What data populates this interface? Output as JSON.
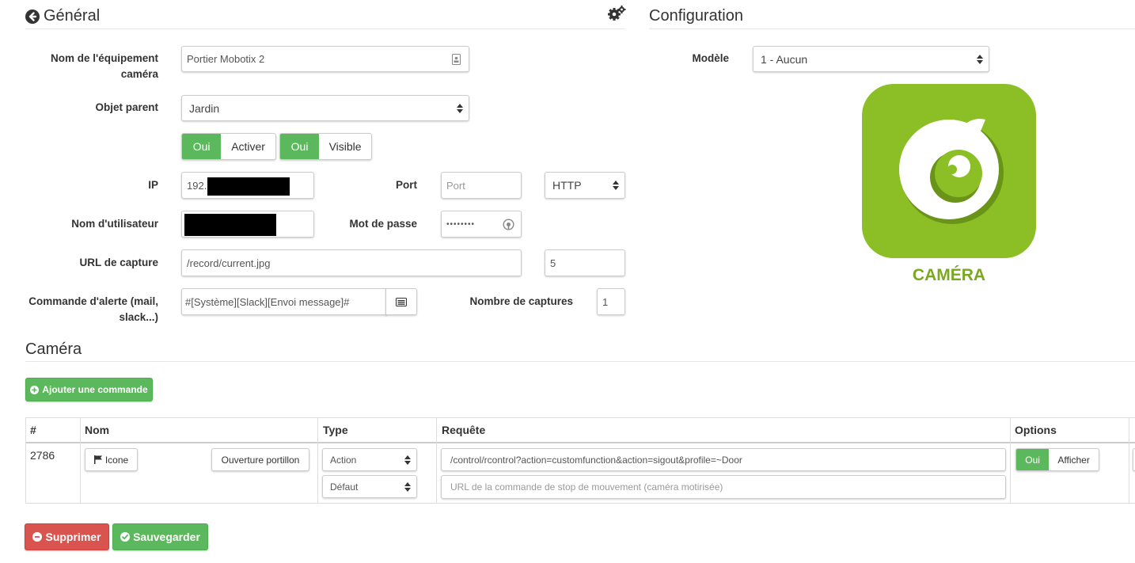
{
  "general": {
    "title": "Général",
    "fields": {
      "name_label": "Nom de l'équipement caméra",
      "name_value": "Portier Mobotix 2",
      "parent_label": "Objet parent",
      "parent_value": "Jardin",
      "toggle_on": "Oui",
      "activate_label": "Activer",
      "visible_label": "Visible",
      "ip_label": "IP",
      "ip_value": "192.1",
      "port_label": "Port",
      "port_placeholder": "Port",
      "protocol_value": "HTTP",
      "user_label": "Nom d'utilisateur",
      "password_label": "Mot de passe",
      "password_value": "••••••••",
      "capture_url_label": "URL de capture",
      "capture_url_value": "/record/current.jpg",
      "capture_extra_value": "5",
      "alert_label": "Commande d'alerte (mail, slack...)",
      "alert_value": "#[Système][Slack][Envoi message]#",
      "captures_count_label": "Nombre de captures",
      "captures_count_value": "1"
    }
  },
  "configuration": {
    "title": "Configuration",
    "model_label": "Modèle",
    "model_value": "1 - Aucun",
    "logo_caption": "CAMÉRA"
  },
  "camera": {
    "title": "Caméra",
    "add_button": "Ajouter une commande",
    "columns": [
      "#",
      "Nom",
      "Type",
      "Requête",
      "Options"
    ],
    "row": {
      "id": "2786",
      "icon_button": "Icone",
      "name": "Ouverture portillon",
      "type": "Action",
      "subtype": "Défaut",
      "request": "/control/rcontrol?action=customfunction&action=sigout&profile=~Door",
      "stop_placeholder": "URL de la commande de stop de mouvement (caméra motirisée)",
      "option_on": "Oui",
      "option_label": "Afficher"
    }
  },
  "footer": {
    "delete_button": "Supprimer",
    "save_button": "Sauvegarder"
  },
  "colors": {
    "green": "#5cb85c",
    "red": "#d9534f",
    "logo_green": "#8cbf26"
  }
}
